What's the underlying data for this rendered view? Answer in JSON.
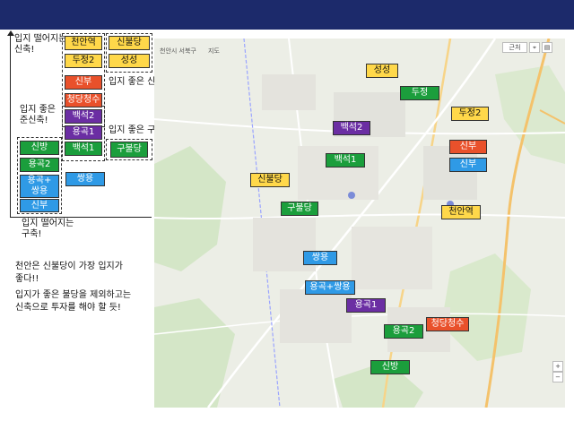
{
  "slide": {
    "axis_top_label": "입지 떨어지는\n신축!",
    "axis_mid_label": "입지 좋은\n준신축!",
    "axis_bottom_label": "입지 떨어지는\n구축!",
    "good_new_label": "입지 좋은 신축!",
    "good_old_label": "입지 좋은 구축!",
    "note_line1": "천안은 신불당이 가장 입지가",
    "note_line2": "좋다!!",
    "note_line3": "입지가 좋은 불당을 제외하고는",
    "note_line4": "신축으로 투자를 해야 할 듯!"
  },
  "left_tags": {
    "cheonanyeok": "천안역",
    "sinbuldang": "신불당",
    "dujeong2": "두정2",
    "seongseong": "성성",
    "sinbu": "신부",
    "cheongdang": "청당청수",
    "baekseok2": "백석2",
    "yonggok1": "용곡1",
    "baekseok1": "백석1",
    "guldang": "구불당",
    "sinbang": "신방",
    "yonggok2": "용곡2",
    "yonggok_ssangyong": "용곡+\n쌍용",
    "sinbu2": "신부",
    "ssangyong": "쌍용"
  },
  "map_tags": {
    "seongseong": "성성",
    "dujeong": "두정",
    "dujeong2": "두정2",
    "baekseok2": "백석2",
    "sinbu": "신부",
    "sinbu2": "신부",
    "baekseok1": "백석1",
    "sinbuldang": "신불당",
    "guldang": "구불당",
    "cheonanyeok": "천안역",
    "ssangyong": "쌍용",
    "yonggok_ssangyong": "용곡+쌍용",
    "yonggok1": "용곡1",
    "cheongdang": "청당청수",
    "yonggok2": "용곡2",
    "sinbang": "신방"
  },
  "map_toolbar": {
    "search": "천안시 서북구",
    "zoom_label": "지도",
    "right_label": "근처"
  },
  "colors": {
    "topbar": "#1c2a6b",
    "yellow": "#ffd84a",
    "green": "#1b9e3c",
    "purple": "#6b2ea3",
    "blue": "#2f9ae6",
    "red": "#e9512b"
  }
}
